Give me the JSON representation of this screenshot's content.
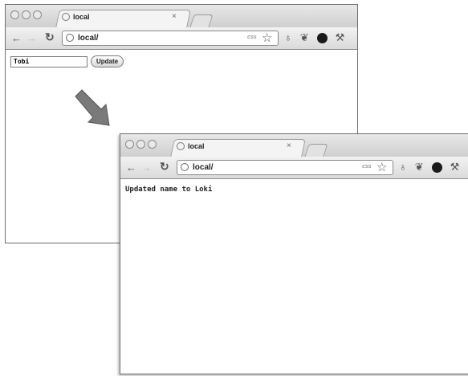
{
  "window1": {
    "tab_title": "local",
    "tab_close": "×",
    "url": "local/",
    "css_badge": "css",
    "input_value": "Tobi",
    "button_label": "Update"
  },
  "window2": {
    "tab_title": "local",
    "tab_close": "×",
    "url": "local/",
    "css_badge": "css",
    "message": "Updated name to Loki"
  },
  "icons": [
    "back-arrow-icon",
    "forward-arrow-icon",
    "reload-icon",
    "globe-icon",
    "star-icon",
    "extension-icon",
    "puzzle-icon",
    "dark-circle-icon",
    "wrench-icon"
  ],
  "colors": {
    "arrow": "#7a7a7a",
    "chrome_frame": "#cfcfcf"
  }
}
